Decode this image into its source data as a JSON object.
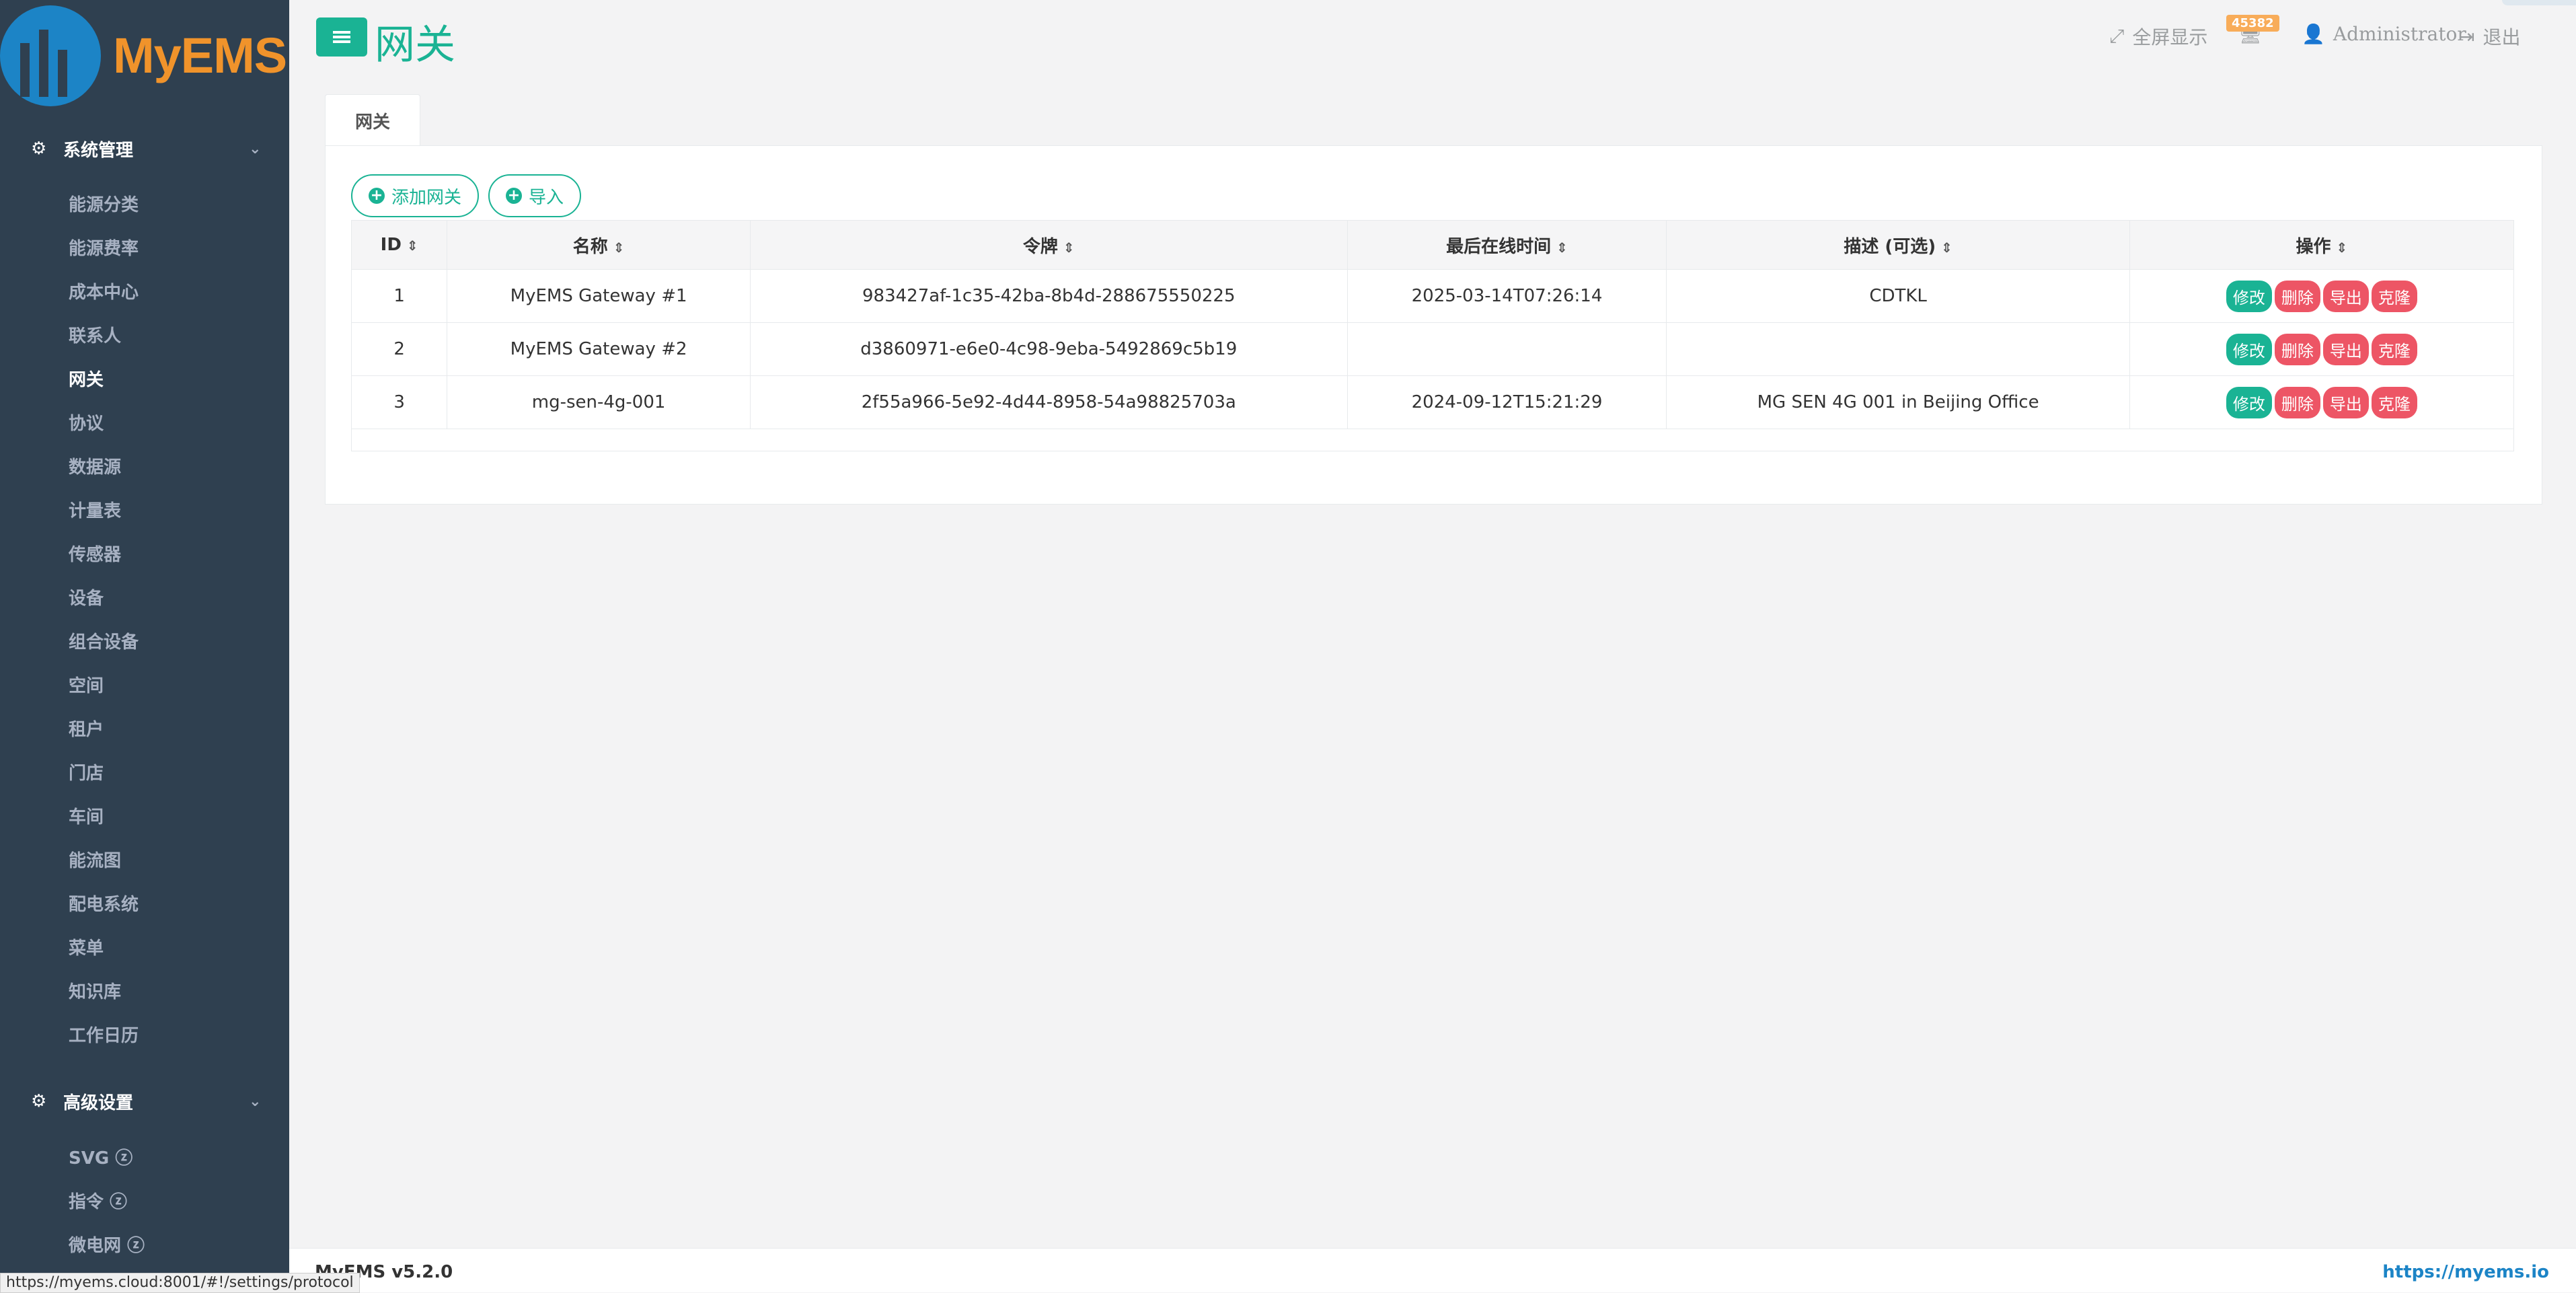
{
  "app": {
    "logo_text": "MyEMS",
    "page_title": "网关"
  },
  "colors": {
    "accent": "#1ab394",
    "danger": "#ed5565",
    "sidebar_bg": "#2f4050",
    "logo_orange": "#f0932b",
    "logo_blue": "#1c84c6"
  },
  "sidebar": {
    "section1": {
      "label": "系统管理",
      "icon": "gears-icon"
    },
    "items1": [
      "能源分类",
      "能源费率",
      "成本中心",
      "联系人",
      "网关",
      "协议",
      "数据源",
      "计量表",
      "传感器",
      "设备",
      "组合设备",
      "空间",
      "租户",
      "门店",
      "车间",
      "能流图",
      "配电系统",
      "菜单",
      "知识库",
      "工作日历"
    ],
    "section2": {
      "label": "高级设置",
      "icon": "gears-icon"
    },
    "items2": [
      "SVG ⓩ",
      "指令 ⓩ",
      "微电网 ⓩ"
    ]
  },
  "topbar": {
    "fullscreen": "全屏显示",
    "notification_count": "45382",
    "user": "Administrator",
    "logout": "退出"
  },
  "tabs": [
    "网关"
  ],
  "toolbar": {
    "add_label": "添加网关",
    "import_label": "导入"
  },
  "table": {
    "headers": [
      "ID",
      "名称",
      "令牌",
      "最后在线时间",
      "描述 (可选)",
      "操作"
    ],
    "rows": [
      [
        "1",
        "MyEMS Gateway #1",
        "983427af-1c35-42ba-8b4d-288675550225",
        "2025-03-14T07:26:14",
        "CDTKL"
      ],
      [
        "2",
        "MyEMS Gateway #2",
        "d3860971-e6e0-4c98-9eba-5492869c5b19",
        "",
        ""
      ],
      [
        "3",
        "mg-sen-4g-001",
        "2f55a966-5e92-4d44-8958-54a98825703a",
        "2024-09-12T15:21:29",
        "MG SEN 4G 001 in Beijing Office"
      ]
    ],
    "actions": [
      "修改",
      "删除",
      "导出",
      "克隆"
    ]
  },
  "footer": {
    "version": "MyEMS v5.2.0",
    "link": "https://myems.io"
  },
  "statusbar": {
    "url": "https://myems.cloud:8001/#!/settings/protocol"
  }
}
